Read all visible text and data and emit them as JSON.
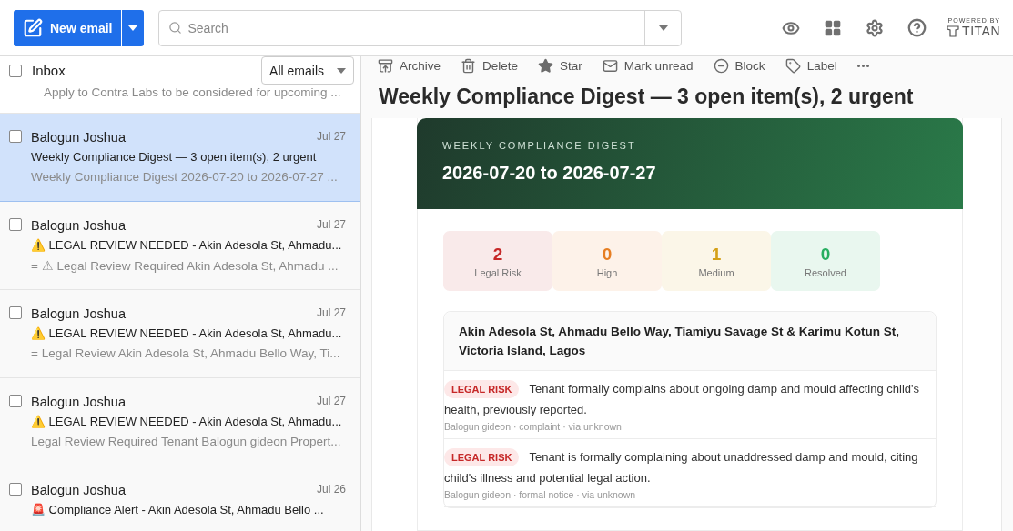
{
  "toolbar": {
    "new_email": "New email",
    "search": {
      "placeholder": "Search"
    },
    "powered_by": "POWERED BY",
    "brand": "TITAN"
  },
  "inbox": {
    "title": "Inbox",
    "checked": false,
    "filter": "All emails",
    "emails": [
      {
        "kind": "partial",
        "selected": false,
        "preview": "Apply to Contra Labs to be considered for upcoming ..."
      },
      {
        "kind": "full",
        "checked": false,
        "selected": true,
        "sender": "Balogun Joshua",
        "date": "Jul 27",
        "subject": "Weekly Compliance Digest — 3 open item(s), 2 urgent",
        "preview": "Weekly Compliance Digest 2026-07-20 to 2026-07-27 ..."
      },
      {
        "kind": "full",
        "checked": false,
        "selected": false,
        "sender": "Balogun Joshua",
        "date": "Jul 27",
        "subject": "⚠️ LEGAL REVIEW NEEDED - Akin Adesola St, Ahmadu...",
        "preview": "= ⚠ Legal Review Required Akin Adesola St, Ahmadu ..."
      },
      {
        "kind": "full",
        "checked": false,
        "selected": false,
        "sender": "Balogun Joshua",
        "date": "Jul 27",
        "subject": "⚠️ LEGAL REVIEW NEEDED - Akin Adesola St, Ahmadu...",
        "preview": "= Legal Review Akin Adesola St, Ahmadu Bello Way, Ti..."
      },
      {
        "kind": "full",
        "checked": false,
        "selected": false,
        "sender": "Balogun Joshua",
        "date": "Jul 27",
        "subject": "⚠️ LEGAL REVIEW NEEDED - Akin Adesola St, Ahmadu...",
        "preview": "Legal Review Required Tenant Balogun gideon Propert..."
      },
      {
        "kind": "full",
        "checked": false,
        "selected": false,
        "sender": "Balogun Joshua",
        "date": "Jul 26",
        "subject": "🚨 Compliance Alert - Akin Adesola St, Ahmadu Bello ..."
      }
    ]
  },
  "message": {
    "actions": [
      {
        "kind": "archive",
        "label": "Archive"
      },
      {
        "kind": "delete",
        "label": "Delete"
      },
      {
        "kind": "star",
        "label": "Star"
      },
      {
        "kind": "unread",
        "label": "Mark unread"
      },
      {
        "kind": "block",
        "label": "Block"
      },
      {
        "kind": "label",
        "label": "Label"
      },
      {
        "kind": "more"
      }
    ],
    "subject": "Weekly Compliance Digest — 3 open item(s), 2 urgent",
    "body": {
      "eyebrow": "WEEKLY COMPLIANCE DIGEST",
      "range": "2026-07-20 to 2026-07-27",
      "stats": [
        {
          "value": "2",
          "label": "Legal Risk",
          "color": "#c62828"
        },
        {
          "value": "0",
          "label": "High",
          "color": "#e67e22"
        },
        {
          "value": "1",
          "label": "Medium",
          "color": "#d4a017"
        },
        {
          "value": "0",
          "label": "Resolved",
          "color": "#27ae60"
        }
      ],
      "property": {
        "address": "Akin Adesola St, Ahmadu Bello Way, Tiamiyu Savage St & Karimu Kotun St, Victoria Island, Lagos",
        "items": [
          {
            "badge": "LEGAL RISK",
            "text": "Tenant formally complains about ongoing damp and mould affecting child's health, previously reported.",
            "meta": "Balogun gideon · complaint · via unknown"
          },
          {
            "badge": "LEGAL RISK",
            "text": "Tenant is formally complaining about unaddressed damp and mould, citing child's illness and potential legal action.",
            "meta": "Balogun gideon · formal notice · via unknown"
          }
        ]
      }
    }
  }
}
